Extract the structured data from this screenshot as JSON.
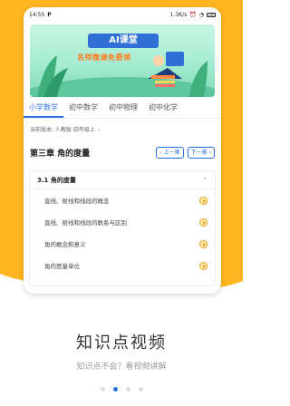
{
  "status": {
    "time": "14:55",
    "speed": "1.3K/s",
    "battery": "100"
  },
  "banner": {
    "title": "AI课堂",
    "subtitle": "名师微课免费领"
  },
  "tabs": [
    "小学数学",
    "初中数学",
    "初中物理",
    "初中化学"
  ],
  "version": "当前版本: 人教版 四年级上",
  "chapter": {
    "title": "第三章 角的度量",
    "prev": "上一章",
    "next": "下一章"
  },
  "section": {
    "title": "3.1 角的度量",
    "lessons": [
      "直线、射线和线段的概念",
      "直线、射线和线段的联系与区别",
      "角的概念和意义",
      "角的度量单位"
    ]
  },
  "headline": "知识点视频",
  "subline": "知识点不会？看视频讲解",
  "colors": {
    "accent": "#2c6fe0",
    "brand": "#FFB51F"
  }
}
